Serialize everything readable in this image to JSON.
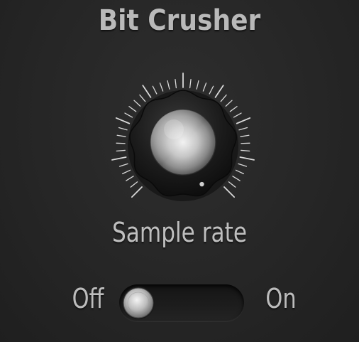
{
  "title": "Bit Crusher",
  "knob": {
    "label": "Sample rate",
    "value_fraction": 0.5
  },
  "switch": {
    "off_label": "Off",
    "on_label": "On",
    "state": "off"
  },
  "colors": {
    "background": "#262626",
    "text": "#bcbcbc",
    "tick": "#d9d9d9"
  }
}
